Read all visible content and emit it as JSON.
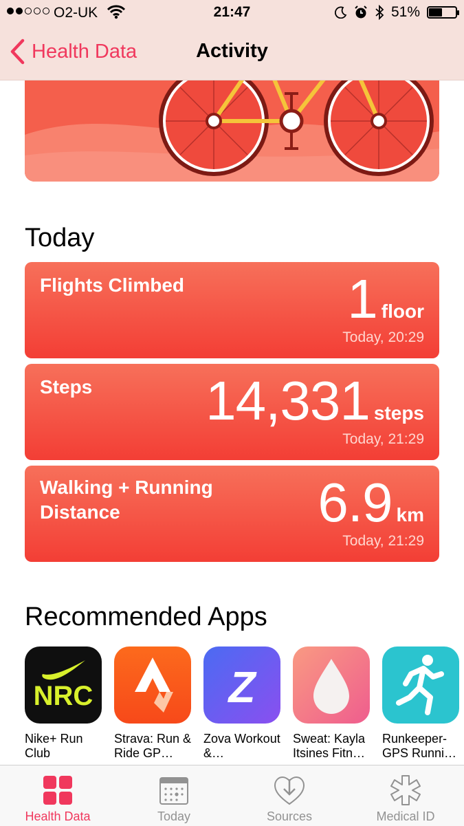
{
  "status_bar": {
    "carrier": "O2-UK",
    "time": "21:47",
    "battery": "51%",
    "battery_level": 0.51
  },
  "nav": {
    "back_label": "Health Data",
    "title": "Activity"
  },
  "today": {
    "title": "Today",
    "cards": [
      {
        "label": "Flights Climbed",
        "value": "1",
        "unit": "floor",
        "time": "Today, 20:29"
      },
      {
        "label": "Steps",
        "value": "14,331",
        "unit": "steps",
        "time": "Today, 21:29"
      },
      {
        "label": "Walking + Running Distance",
        "value": "6.9",
        "unit": "km",
        "time": "Today, 21:29"
      }
    ]
  },
  "recommended": {
    "title": "Recommended Apps",
    "apps": [
      {
        "name": "Nike+ Run Club",
        "icon": "nrc-icon",
        "icon_text": "NRC"
      },
      {
        "name": "Strava: Run & Ride GP…",
        "icon": "strava-icon"
      },
      {
        "name": "Zova Workout &…",
        "icon": "zova-icon",
        "icon_text": "Z"
      },
      {
        "name": "Sweat: Kayla Itsines Fitn…",
        "icon": "sweat-drop-icon"
      },
      {
        "name": "Runkeeper- GPS Runni…",
        "icon": "runkeeper-runner-icon"
      }
    ]
  },
  "tabbar": {
    "tabs": [
      {
        "label": "Health Data",
        "icon": "health-data-icon",
        "active": true
      },
      {
        "label": "Today",
        "icon": "calendar-icon",
        "active": false
      },
      {
        "label": "Sources",
        "icon": "sources-heart-icon",
        "active": false
      },
      {
        "label": "Medical ID",
        "icon": "medical-id-icon",
        "active": false
      }
    ]
  },
  "colors": {
    "accent": "#f0385d",
    "card_top": "#f7705a",
    "card_bottom": "#f33e35"
  }
}
